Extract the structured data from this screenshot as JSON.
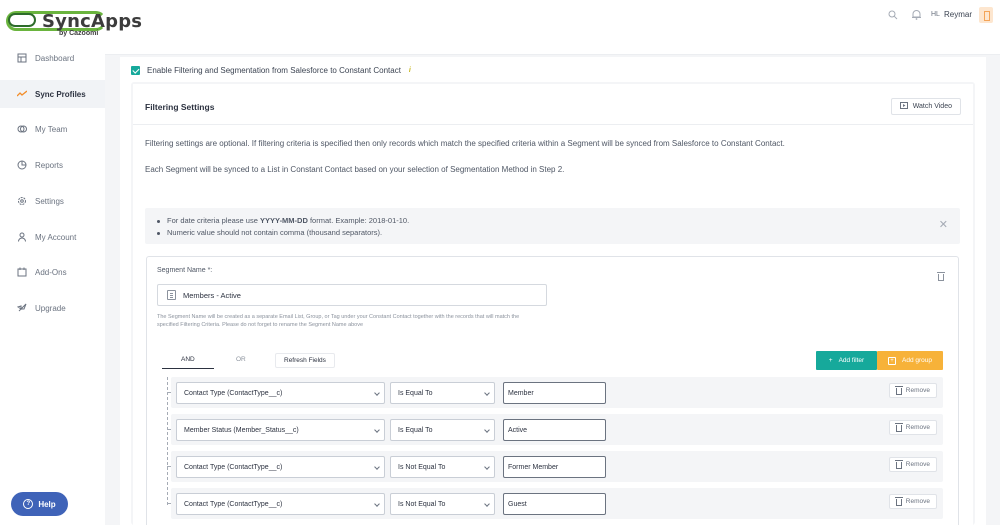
{
  "brand": {
    "name": "SyncApps",
    "sub": "by Cazoomi"
  },
  "topbar": {
    "search_icon": "search-icon",
    "bell_icon": "bell-icon",
    "user_initials": "HL",
    "user_name": "Reymar"
  },
  "sidebar": {
    "items": [
      {
        "label": "Dashboard",
        "icon": "dashboard-icon",
        "active": false
      },
      {
        "label": "Sync Profiles",
        "icon": "sync-icon",
        "active": true
      },
      {
        "label": "My Team",
        "icon": "team-icon",
        "active": false
      },
      {
        "label": "Reports",
        "icon": "reports-icon",
        "active": false
      },
      {
        "label": "Settings",
        "icon": "gear-icon",
        "active": false
      },
      {
        "label": "My Account",
        "icon": "user-icon",
        "active": false
      },
      {
        "label": "Add-Ons",
        "icon": "addons-icon",
        "active": false
      },
      {
        "label": "Upgrade",
        "icon": "rocket-icon",
        "active": false
      }
    ],
    "help_label": "Help"
  },
  "main": {
    "enable_label": "Enable Filtering and Segmentation from Salesforce to Constant Contact",
    "enable_checked": true,
    "settings_title": "Filtering Settings",
    "watch_video_label": "Watch Video",
    "desc1": "Filtering settings are optional.  If filtering criteria is specified then only records which match the specified criteria within a Segment will be synced from Salesforce to Constant Contact.",
    "desc2": "Each Segment will be synced to a List in Constant Contact based on your selection of Segmentation Method in Step 2.",
    "notes": {
      "date_prefix": "For date criteria please use ",
      "date_format": "YYYY-MM-DD",
      "date_suffix": " format. Example: 2018-01-10.",
      "numeric": "Numeric value should not contain comma (thousand separators)."
    },
    "segment": {
      "name_label": "Segment Name *:",
      "name_value": "Members - Active",
      "help_text": "The Segment Name will be created as a separate Email List, Group, or Tag under your Constant Contact together with the records that will match the specified Filtering Criteria. Please do not forget to rename the Segment Name above",
      "tab_and": "AND",
      "tab_or": "OR",
      "refresh_label": "Refresh Fields",
      "add_filter_label": "Add filter",
      "add_group_label": "Add group",
      "remove_label": "Remove",
      "filters": [
        {
          "field": "Contact Type (ContactType__c)",
          "operator": "Is Equal To",
          "value": "Member"
        },
        {
          "field": "Member Status (Member_Status__c)",
          "operator": "Is Equal To",
          "value": "Active"
        },
        {
          "field": "Contact Type (ContactType__c)",
          "operator": "Is Not Equal To",
          "value": "Former Member"
        },
        {
          "field": "Contact Type (ContactType__c)",
          "operator": "Is Not Equal To",
          "value": "Guest"
        }
      ]
    }
  },
  "colors": {
    "accent": "#16a99b",
    "warning": "#f7b239",
    "help": "#3f63b8"
  }
}
